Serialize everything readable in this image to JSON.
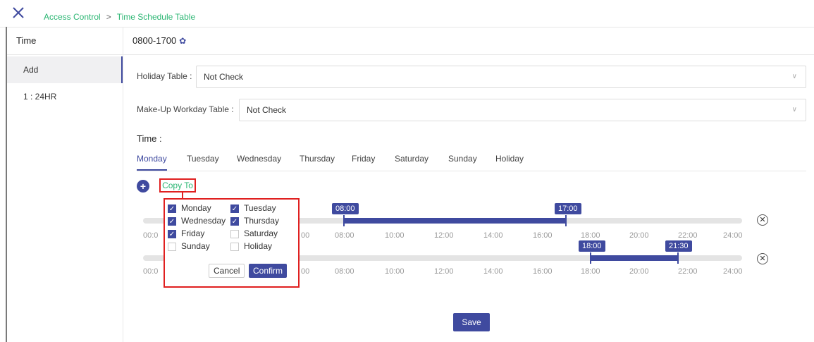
{
  "breadcrumb": {
    "root": "Access Control",
    "separator": ">",
    "current": "Time Schedule Table"
  },
  "sidebar": {
    "title": "Time",
    "items": [
      {
        "label": "Add",
        "active": true
      },
      {
        "label": "1 : 24HR",
        "active": false
      }
    ]
  },
  "main": {
    "title": "0800-1700",
    "title_icon": "gear-icon",
    "holiday_label": "Holiday Table :",
    "holiday_value": "Not Check",
    "makeup_label": "Make-Up Workday Table :",
    "makeup_value": "Not Check",
    "time_label": "Time :",
    "tabs": [
      "Monday",
      "Tuesday",
      "Wednesday",
      "Thursday",
      "Friday",
      "Saturday",
      "Sunday",
      "Holiday"
    ],
    "active_tab": "Monday",
    "copy_to_label": "Copy To",
    "save_label": "Save"
  },
  "timelines": [
    {
      "start": "08:00",
      "end": "17:00",
      "ticks": [
        "00:0",
        "00",
        "08:00",
        "10:00",
        "12:00",
        "14:00",
        "16:00",
        "18:00",
        "20:00",
        "22:00",
        "24:00"
      ]
    },
    {
      "start": "18:00",
      "end": "21:30",
      "ticks": [
        "00:0",
        "00",
        "08:00",
        "10:00",
        "12:00",
        "14:00",
        "16:00",
        "18:00",
        "20:00",
        "22:00",
        "24:00"
      ]
    }
  ],
  "copy_popup": {
    "days": [
      {
        "label": "Monday",
        "checked": true
      },
      {
        "label": "Tuesday",
        "checked": true
      },
      {
        "label": "Wednesday",
        "checked": true
      },
      {
        "label": "Thursday",
        "checked": true
      },
      {
        "label": "Friday",
        "checked": true
      },
      {
        "label": "Saturday",
        "checked": false
      },
      {
        "label": "Sunday",
        "checked": false
      },
      {
        "label": "Holiday",
        "checked": false
      }
    ],
    "cancel_label": "Cancel",
    "confirm_label": "Confirm"
  },
  "colors": {
    "accent": "#3f4a9f",
    "link_green": "#2bb673",
    "highlight_red": "#e02020"
  }
}
